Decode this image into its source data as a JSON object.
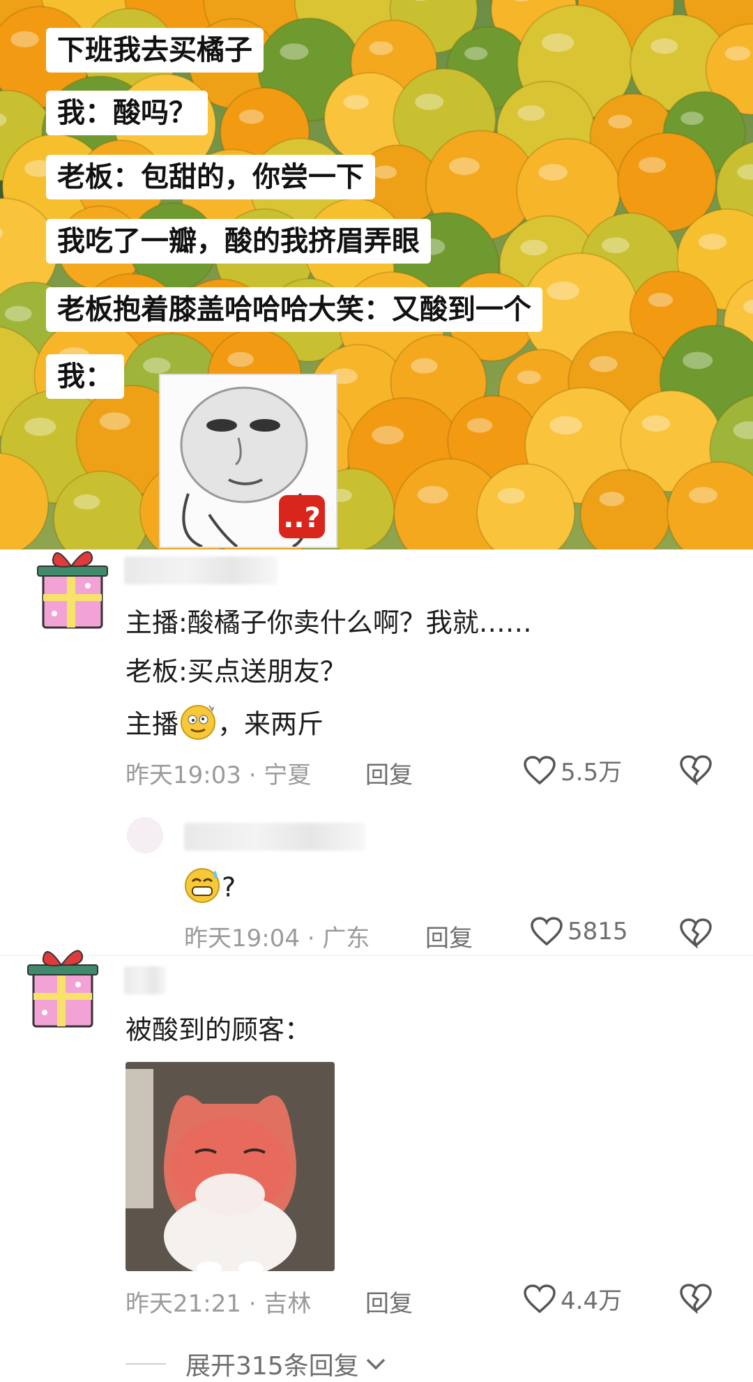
{
  "photo_captions": [
    "下班我去买橘子",
    "我：酸吗？",
    "老板：包甜的，你尝一下",
    "我吃了一瓣，酸的我挤眉弄眼",
    "老板抱着膝盖哈哈哈大笑：又酸到一个",
    "我："
  ],
  "comments": [
    {
      "lines": [
        "主播:酸橘子你卖什么啊？我就……",
        "老板:买点送朋友？",
        "主播",
        "，来两斤"
      ],
      "time": "昨天19:03",
      "location": "宁夏",
      "reply_label": "回复",
      "likes": "5.5万"
    },
    {
      "text_suffix": "?",
      "time": "昨天19:04",
      "location": "广东",
      "reply_label": "回复",
      "likes": "5815"
    },
    {
      "text": "被酸到的顾客：",
      "time": "昨天21:21",
      "location": "吉林",
      "reply_label": "回复",
      "likes": "4.4万"
    }
  ],
  "expand_label": "展开315条回复",
  "meta_separator": "·",
  "colors": {
    "meta_gray": "#9a9a9a",
    "text_dark": "#1c1c1c",
    "orange": "#f2a21b",
    "green": "#4f8a2a"
  }
}
